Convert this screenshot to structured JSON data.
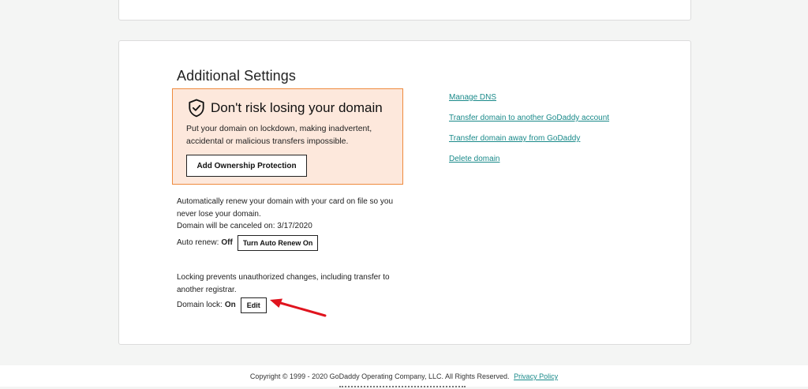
{
  "additional_settings": {
    "title": "Additional Settings"
  },
  "protection_promo": {
    "title": "Don't risk losing your domain",
    "description": "Put your domain on lockdown, making inadvertent, accidental or malicious transfers impossible.",
    "button_label": "Add Ownership Protection",
    "icon": "shield-check-icon",
    "accent_color": "#ef8a3e",
    "background_color": "#fde8dc"
  },
  "auto_renew": {
    "description": "Automatically renew your domain with your card on file so you never lose your domain.",
    "cancel_notice": "Domain will be canceled on: 3/17/2020",
    "label": "Auto renew:",
    "status": "Off",
    "button_label": "Turn Auto Renew On"
  },
  "domain_lock": {
    "description": "Locking prevents unauthorized changes, including transfer to another registrar.",
    "label": "Domain lock:",
    "status": "On",
    "button_label": "Edit",
    "annotation": "red-arrow-icon",
    "annotation_color": "#e0141e"
  },
  "links": [
    {
      "label": "Manage DNS"
    },
    {
      "label": "Transfer domain to another GoDaddy account"
    },
    {
      "label": "Transfer domain away from GoDaddy"
    },
    {
      "label": "Delete domain"
    }
  ],
  "link_color": "#1a8a8a",
  "footer": {
    "copyright": "Copyright © 1999 - 2020 GoDaddy Operating Company, LLC. All Rights Reserved.",
    "privacy_link": "Privacy Policy"
  }
}
